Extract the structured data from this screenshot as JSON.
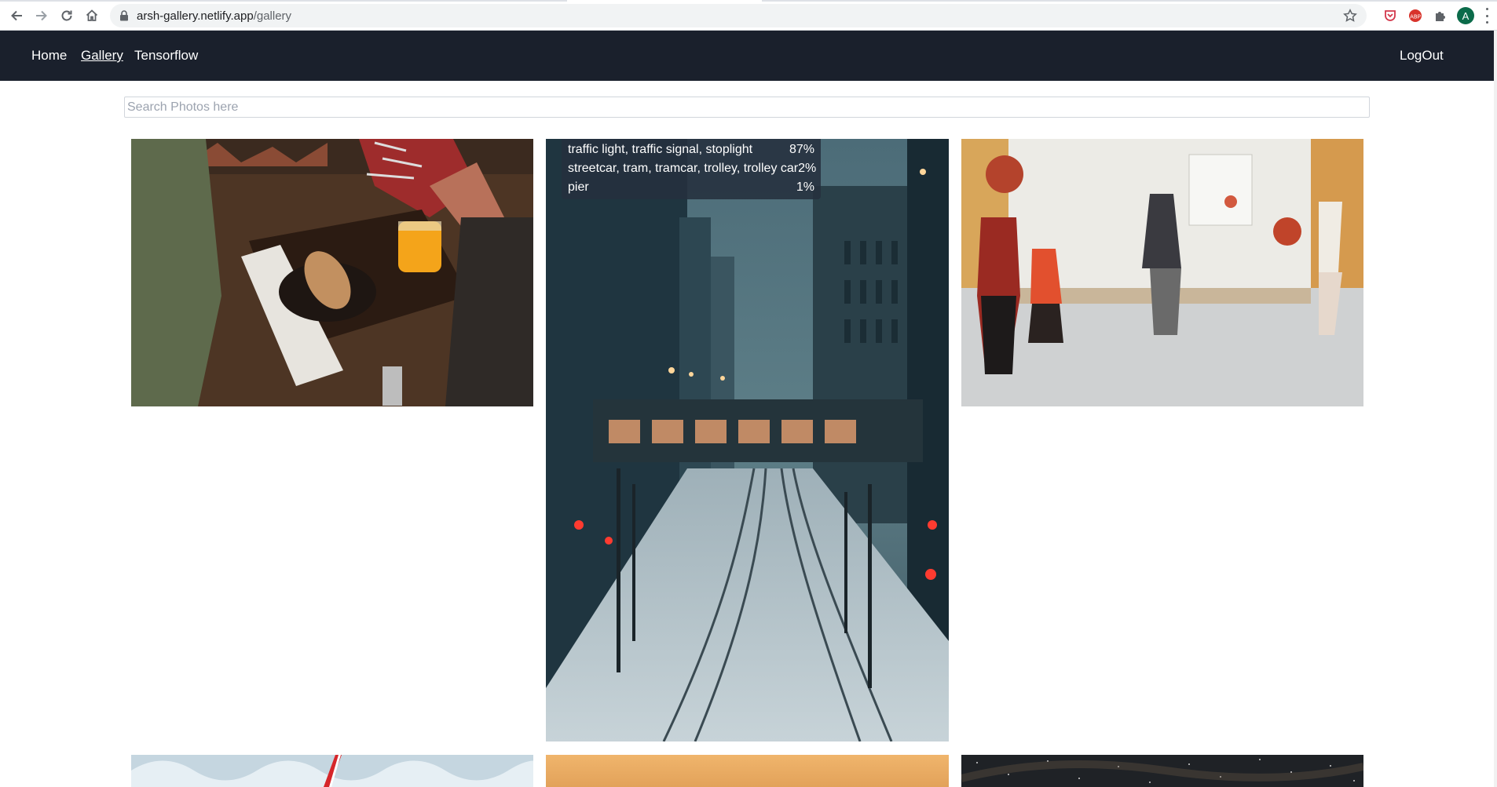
{
  "browser": {
    "url_host": "arsh-gallery.netlify.app",
    "url_path": "/gallery",
    "avatar_letter": "A",
    "icons": [
      "back-arrow-icon",
      "forward-arrow-icon",
      "reload-icon",
      "home-icon",
      "lock-icon",
      "star-icon",
      "pocket-icon",
      "adblock-icon",
      "puzzle-icon",
      "menu-kebab-icon"
    ]
  },
  "nav": {
    "links": [
      {
        "label": "Home",
        "active": false
      },
      {
        "label": "Gallery",
        "active": true
      },
      {
        "label": "Tensorflow",
        "active": false
      }
    ],
    "logout_label": "LogOut",
    "background": "#1a202c"
  },
  "search": {
    "placeholder": "Search Photos here",
    "value": ""
  },
  "gallery": {
    "photos": [
      {
        "subject": "hand holding sandwich over wooden tray with orange juice"
      },
      {
        "subject": "snowy city street with tram tracks and skybridge",
        "predictions": [
          {
            "label": "traffic light, traffic signal, stoplight",
            "score": "87%"
          },
          {
            "label": "streetcar, tram, tramcar, trolley, trolley car",
            "score": "2%"
          },
          {
            "label": "pier",
            "score": "1%"
          }
        ]
      },
      {
        "subject": "children playing with balloons in bright room"
      },
      {
        "subject": "snowy tree with candy cane"
      },
      {
        "subject": "warm orange gradient"
      },
      {
        "subject": "starry night sky"
      }
    ]
  }
}
